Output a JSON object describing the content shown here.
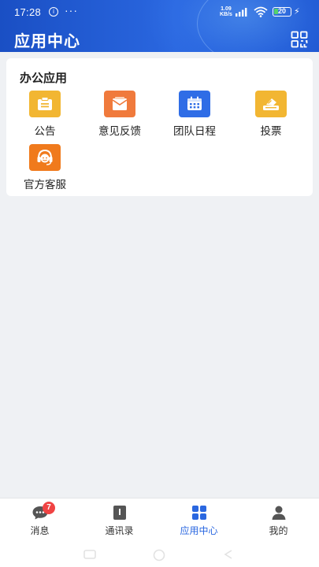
{
  "status_bar": {
    "time": "17:28",
    "info_glyph": "i",
    "dots": "···",
    "speed_value": "1.09",
    "speed_unit": "KB/s",
    "battery": "20",
    "charging_glyph": "⚡"
  },
  "header": {
    "title": "应用中心",
    "scan_icon": "scan-qr-icon",
    "color": "#2a67e0"
  },
  "section": {
    "title": "办公应用",
    "apps": [
      {
        "label": "公告",
        "icon": "notice-icon",
        "color": "#f2b632"
      },
      {
        "label": "意见反馈",
        "icon": "feedback-icon",
        "color": "#f07a3c"
      },
      {
        "label": "团队日程",
        "icon": "calendar-icon",
        "color": "#2f6de6"
      },
      {
        "label": "投票",
        "icon": "vote-icon",
        "color": "#f2b632"
      },
      {
        "label": "官方客服",
        "icon": "customer-service-icon",
        "color": "#f07a1c"
      }
    ]
  },
  "tabbar": {
    "tabs": [
      {
        "label": "消息",
        "icon": "message-icon",
        "badge": "7"
      },
      {
        "label": "通讯录",
        "icon": "contacts-icon"
      },
      {
        "label": "应用中心",
        "icon": "apps-grid-icon",
        "active": true
      },
      {
        "label": "我的",
        "icon": "profile-icon"
      }
    ],
    "active_color": "#2a67e0"
  }
}
